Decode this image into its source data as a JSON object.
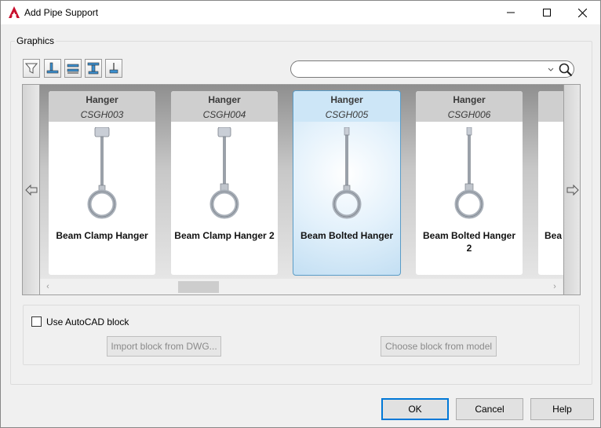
{
  "window": {
    "title": "Add Pipe Support"
  },
  "graphics": {
    "label": "Graphics",
    "toolbar": [
      {
        "icon": "filter-icon"
      },
      {
        "icon": "support-base-icon"
      },
      {
        "icon": "support-beam-icon"
      },
      {
        "icon": "support-t-icon"
      },
      {
        "icon": "support-hanger-icon"
      }
    ],
    "search": {
      "value": "",
      "placeholder": ""
    }
  },
  "gallery": {
    "cards": [
      {
        "type": "Hanger",
        "code": "CSGH003",
        "name": "Beam Clamp Hanger",
        "selected": false
      },
      {
        "type": "Hanger",
        "code": "CSGH004",
        "name": "Beam Clamp Hanger 2",
        "selected": false
      },
      {
        "type": "Hanger",
        "code": "CSGH005",
        "name": "Beam Bolted Hanger",
        "selected": true
      },
      {
        "type": "Hanger",
        "code": "CSGH006",
        "name": "Beam Bolted Hanger 2",
        "selected": false
      },
      {
        "type": "",
        "code": "",
        "name": "Bea",
        "selected": false
      }
    ]
  },
  "autocad": {
    "checkbox_label": "Use AutoCAD block",
    "checked": false,
    "import_label": "Import block from DWG...",
    "choose_label": "Choose block from model"
  },
  "footer": {
    "ok": "OK",
    "cancel": "Cancel",
    "help": "Help"
  },
  "colors": {
    "accent": "#0078d7",
    "selection": "#5a9cc7"
  }
}
